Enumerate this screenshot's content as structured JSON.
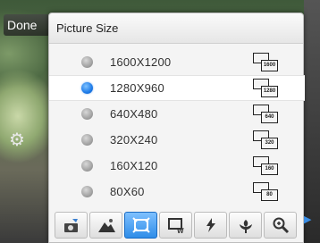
{
  "header": {
    "done_label": "Done"
  },
  "dialog": {
    "title": "Picture Size",
    "options": [
      {
        "label": "1600X1200",
        "icon": "size-1600x1200-icon",
        "badge": "1600",
        "selected": false
      },
      {
        "label": "1280X960",
        "icon": "size-1280x960-icon",
        "badge": "1280",
        "selected": true
      },
      {
        "label": "640X480",
        "icon": "size-640x480-icon",
        "badge": "640",
        "selected": false
      },
      {
        "label": "320X240",
        "icon": "size-320x240-icon",
        "badge": "320",
        "selected": false
      },
      {
        "label": "160X120",
        "icon": "size-160x120-icon",
        "badge": "160",
        "selected": false
      },
      {
        "label": "80X60",
        "icon": "size-80x60-icon",
        "badge": "80",
        "selected": false
      }
    ]
  },
  "toolbar": {
    "tools": [
      {
        "icon": "camera-mode-icon",
        "active": false
      },
      {
        "icon": "scene-landscape-icon",
        "active": false
      },
      {
        "icon": "picture-size-icon",
        "active": true
      },
      {
        "icon": "white-balance-icon",
        "active": false
      },
      {
        "icon": "flash-icon",
        "active": false
      },
      {
        "icon": "macro-icon",
        "active": false
      },
      {
        "icon": "zoom-icon",
        "active": false
      }
    ]
  },
  "colors": {
    "accent": "#2f8de8",
    "dialog_bg": "#f4f4f4",
    "selected_radio": "#1e7be8"
  }
}
